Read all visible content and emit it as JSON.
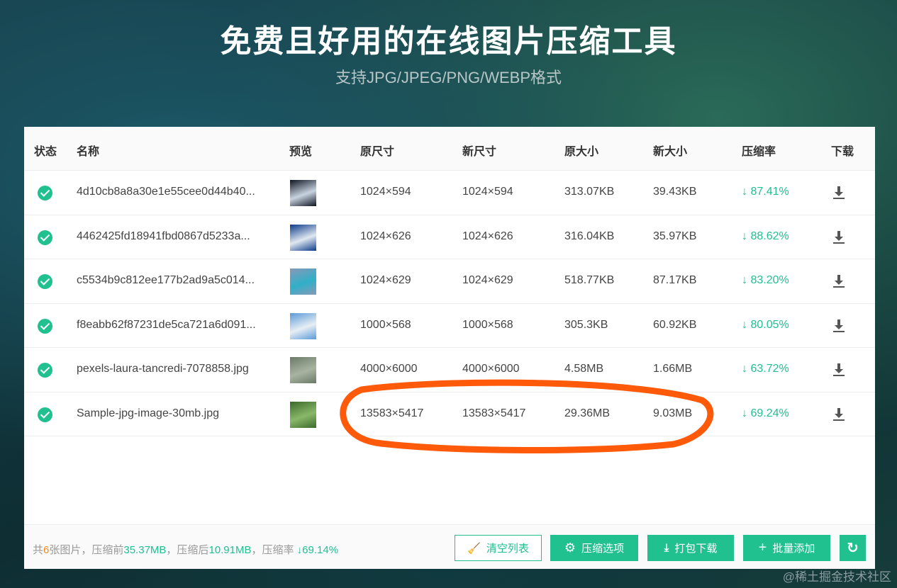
{
  "header": {
    "title": "免费且好用的在线图片压缩工具",
    "subtitle": "支持JPG/JPEG/PNG/WEBP格式"
  },
  "table": {
    "columns": [
      "状态",
      "名称",
      "预览",
      "原尺寸",
      "新尺寸",
      "原大小",
      "新大小",
      "压缩率",
      "下载"
    ],
    "rows": [
      {
        "name": "4d10cb8a8a30e1e55cee0d44b40...",
        "orig_dim": "1024×594",
        "new_dim": "1024×594",
        "orig_size": "313.07KB",
        "new_size": "39.43KB",
        "rate": "87.41%",
        "thumb": [
          "#0d1420",
          "#c8d4e0"
        ]
      },
      {
        "name": "4462425fd18941fbd0867d5233a...",
        "orig_dim": "1024×626",
        "new_dim": "1024×626",
        "orig_size": "316.04KB",
        "new_size": "35.97KB",
        "rate": "88.62%",
        "thumb": [
          "#0c3a8a",
          "#e0e8f0"
        ]
      },
      {
        "name": "c5534b9c812ee177b2ad9a5c014...",
        "orig_dim": "1024×629",
        "new_dim": "1024×629",
        "orig_size": "518.77KB",
        "new_size": "87.17KB",
        "rate": "83.20%",
        "thumb": [
          "#8898b8",
          "#30b0c8"
        ]
      },
      {
        "name": "f8eabb62f87231de5ca721a6d091...",
        "orig_dim": "1000×568",
        "new_dim": "1000×568",
        "orig_size": "305.3KB",
        "new_size": "60.92KB",
        "rate": "80.05%",
        "thumb": [
          "#5a9ad8",
          "#e8eef4"
        ]
      },
      {
        "name": "pexels-laura-tancredi-7078858.jpg",
        "orig_dim": "4000×6000",
        "new_dim": "4000×6000",
        "orig_size": "4.58MB",
        "new_size": "1.66MB",
        "rate": "63.72%",
        "thumb": [
          "#6a7a68",
          "#a8b4a0"
        ]
      },
      {
        "name": "Sample-jpg-image-30mb.jpg",
        "orig_dim": "13583×5417",
        "new_dim": "13583×5417",
        "orig_size": "29.36MB",
        "new_size": "9.03MB",
        "rate": "69.24%",
        "thumb": [
          "#3a6a2a",
          "#8ab86a"
        ]
      }
    ]
  },
  "footer": {
    "p1": "共",
    "count": "6",
    "p2": "张图片，压缩前",
    "before": "35.37MB",
    "p3": "，压缩后",
    "after": "10.91MB",
    "p4": "，压缩率",
    "rate": "69.14%",
    "buttons": {
      "clear": "清空列表",
      "options": "压缩选项",
      "pack": "打包下载",
      "add": "批量添加"
    }
  },
  "watermark": "@稀土掘金技术社区",
  "colors": {
    "accent": "#20c08f",
    "annotation": "#ff5a0a"
  }
}
